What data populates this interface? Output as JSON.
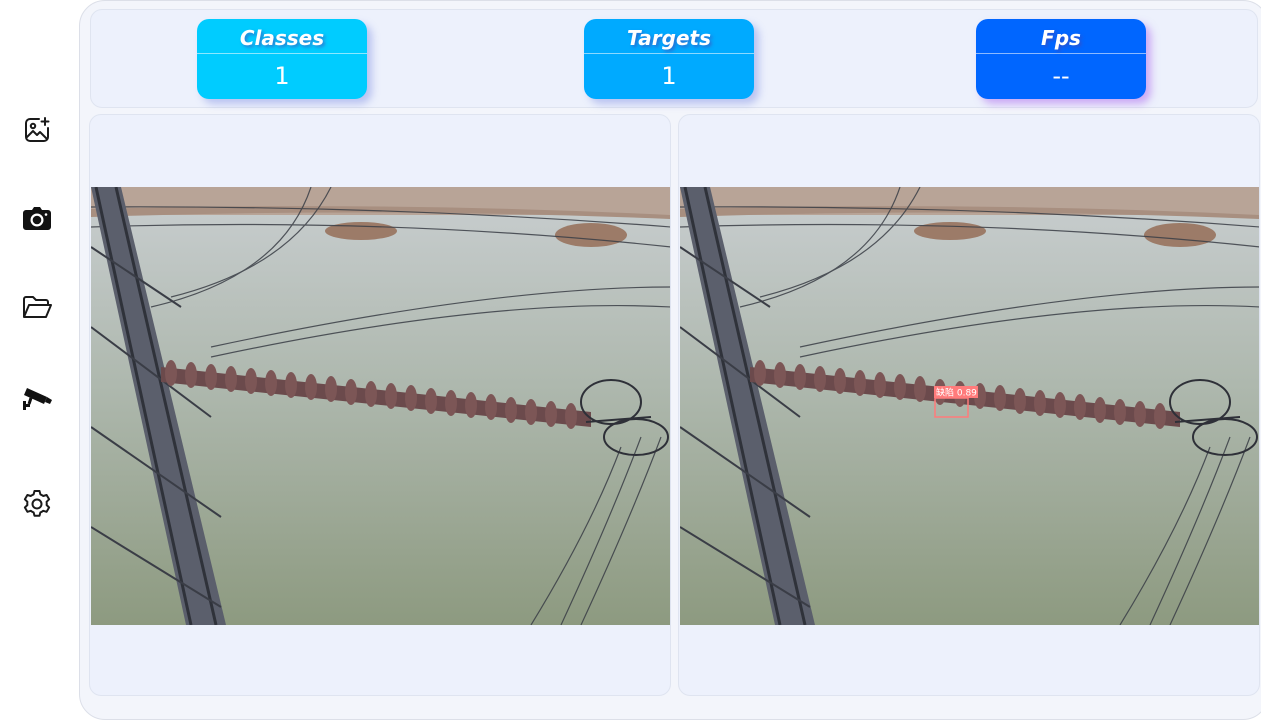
{
  "sidebar": {
    "items": [
      {
        "icon": "add-image-icon"
      },
      {
        "icon": "camera-icon"
      },
      {
        "icon": "folder-open-icon"
      },
      {
        "icon": "cctv-camera-icon"
      },
      {
        "icon": "gear-icon"
      }
    ]
  },
  "stats": {
    "classes": {
      "label": "Classes",
      "value": "1",
      "color": "#00ccff"
    },
    "targets": {
      "label": "Targets",
      "value": "1",
      "color": "#00aaff"
    },
    "fps": {
      "label": "Fps",
      "value": "--",
      "color": "#0066ff"
    }
  },
  "detection": {
    "label": "缺陷 0.89",
    "color": "#ff7b7b"
  }
}
